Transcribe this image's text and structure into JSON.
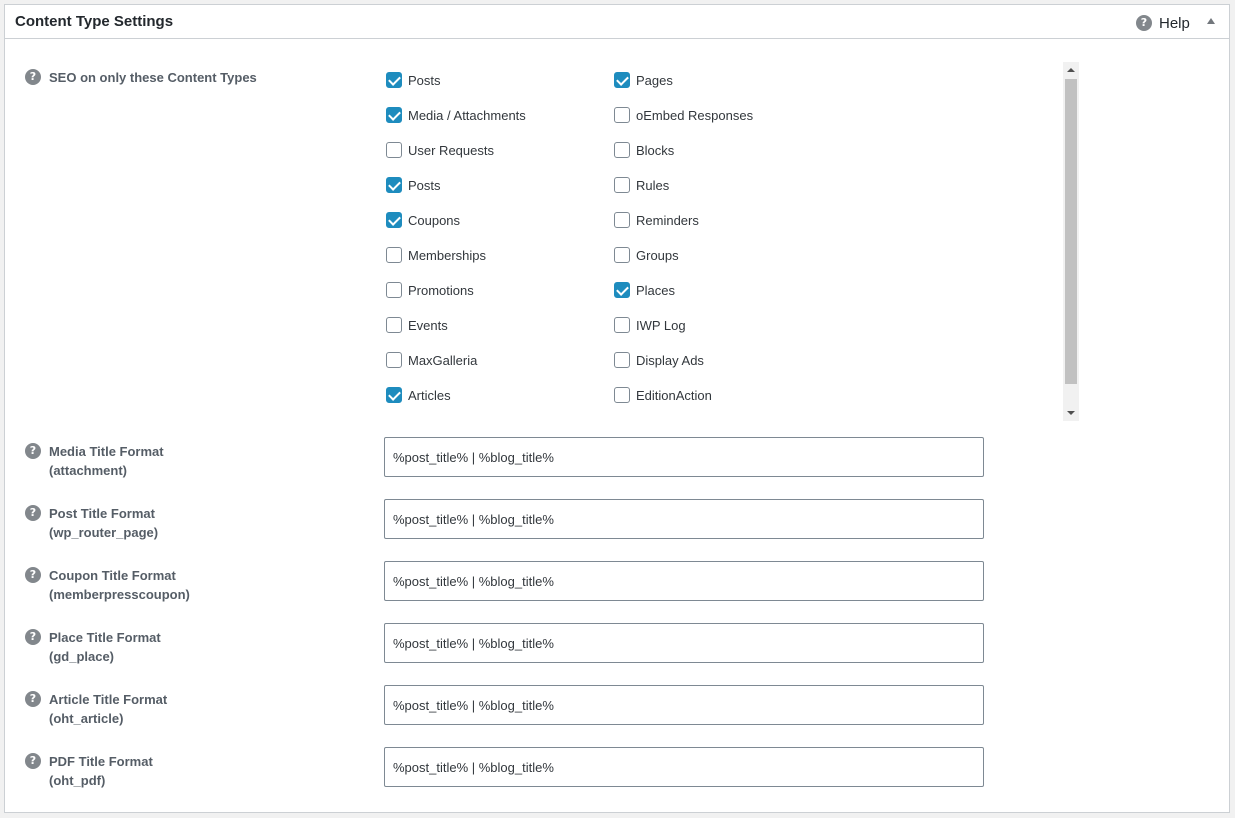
{
  "header": {
    "title": "Content Type Settings",
    "help_label": "Help"
  },
  "seo_row": {
    "label": "SEO on only these Content Types",
    "content_types": [
      {
        "label": "Posts",
        "checked": true
      },
      {
        "label": "Pages",
        "checked": true
      },
      {
        "label": "Media / Attachments",
        "checked": true
      },
      {
        "label": "oEmbed Responses",
        "checked": false
      },
      {
        "label": "User Requests",
        "checked": false
      },
      {
        "label": "Blocks",
        "checked": false
      },
      {
        "label": "Posts",
        "checked": true
      },
      {
        "label": "Rules",
        "checked": false
      },
      {
        "label": "Coupons",
        "checked": true
      },
      {
        "label": "Reminders",
        "checked": false
      },
      {
        "label": "Memberships",
        "checked": false
      },
      {
        "label": "Groups",
        "checked": false
      },
      {
        "label": "Promotions",
        "checked": false
      },
      {
        "label": "Places",
        "checked": true
      },
      {
        "label": "Events",
        "checked": false
      },
      {
        "label": "IWP Log",
        "checked": false
      },
      {
        "label": "MaxGalleria",
        "checked": false
      },
      {
        "label": "Display Ads",
        "checked": false
      },
      {
        "label": "Articles",
        "checked": true
      },
      {
        "label": "EditionAction",
        "checked": false
      },
      {
        "label": "",
        "checked": true
      }
    ]
  },
  "title_formats": [
    {
      "label": "Media Title Format",
      "sublabel": "(attachment)",
      "value": "%post_title% | %blog_title%"
    },
    {
      "label": "Post Title Format",
      "sublabel": "(wp_router_page)",
      "value": "%post_title% | %blog_title%"
    },
    {
      "label": "Coupon Title Format",
      "sublabel": "(memberpresscoupon)",
      "value": "%post_title% | %blog_title%"
    },
    {
      "label": "Place Title Format",
      "sublabel": "(gd_place)",
      "value": "%post_title% | %blog_title%"
    },
    {
      "label": "Article Title Format",
      "sublabel": "(oht_article)",
      "value": "%post_title% | %blog_title%"
    },
    {
      "label": "PDF Title Format",
      "sublabel": "(oht_pdf)",
      "value": "%post_title% | %blog_title%"
    }
  ],
  "icons": {
    "help": "question-circle-icon",
    "toggle": "caret-up-icon",
    "checkbox_checked_color": "#1e8cbe"
  }
}
